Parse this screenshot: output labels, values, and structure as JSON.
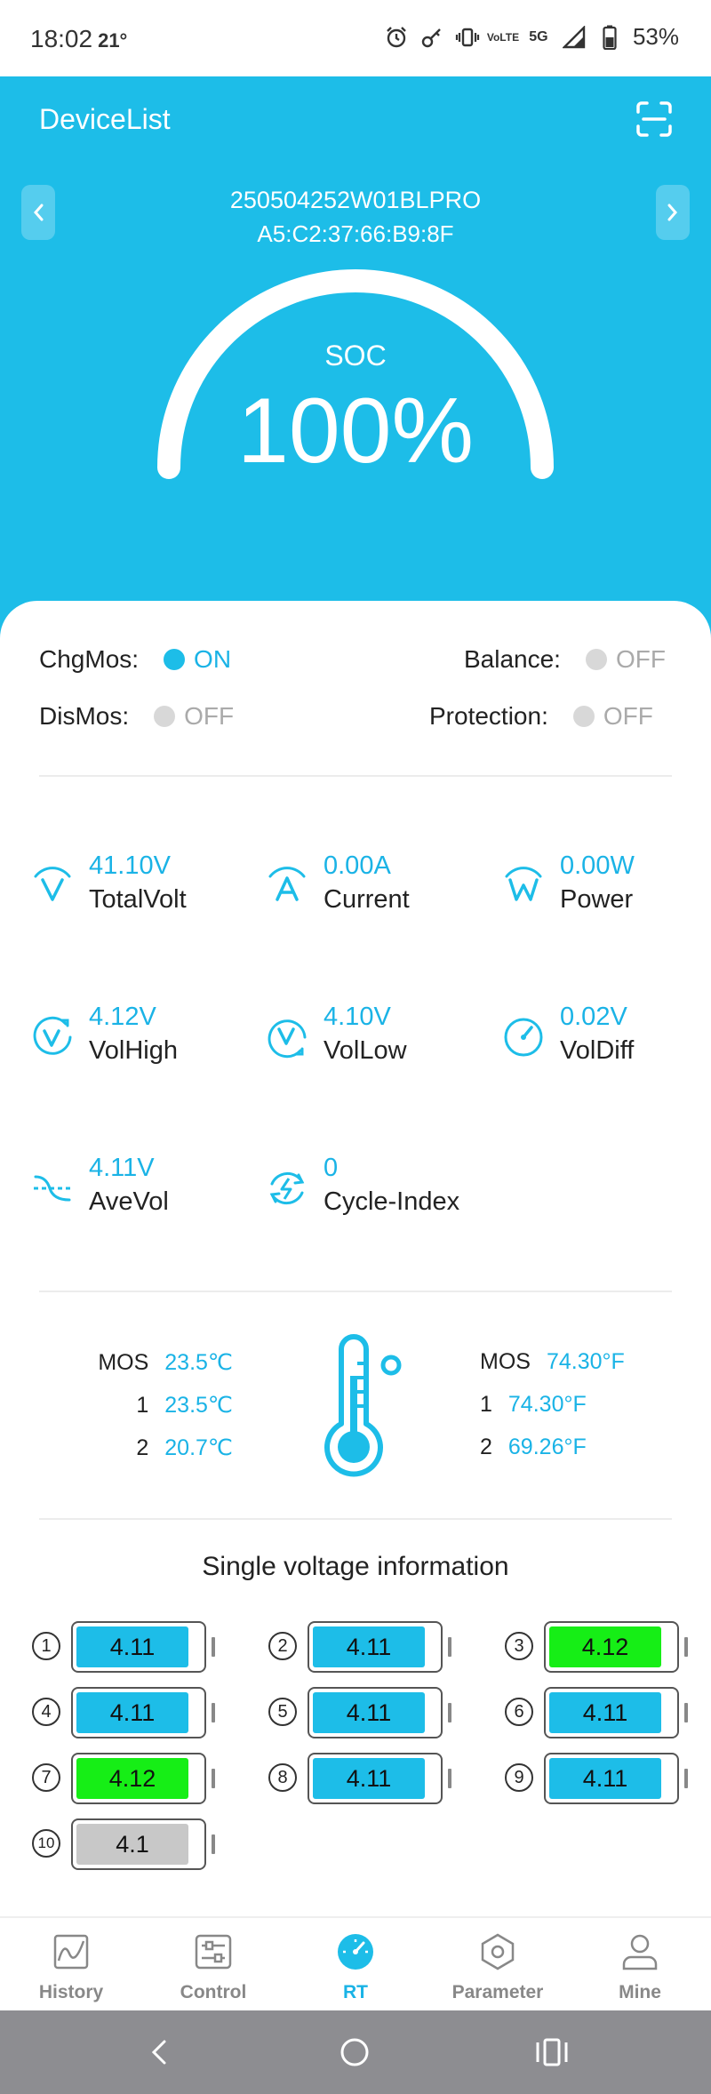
{
  "status_bar": {
    "time": "18:02",
    "temperature": "21°",
    "battery_percent": "53%",
    "net_top": "Vo",
    "net_bottom": "LTE",
    "signal": "5G"
  },
  "header": {
    "title": "DeviceList",
    "device_name": "250504252W01BLPRO",
    "device_mac": "A5:C2:37:66:B9:8F"
  },
  "soc": {
    "label": "SOC",
    "value": "100%",
    "level": 1.0
  },
  "mos": {
    "chg": {
      "label": "ChgMos:",
      "state": "ON",
      "on": true
    },
    "dis": {
      "label": "DisMos:",
      "state": "OFF",
      "on": false
    },
    "balance": {
      "label": "Balance:",
      "state": "OFF",
      "on": false
    },
    "protection": {
      "label": "Protection:",
      "state": "OFF",
      "on": false
    }
  },
  "metrics": {
    "total_volt": {
      "value": "41.10V",
      "label": "TotalVolt"
    },
    "current": {
      "value": "0.00A",
      "label": "Current"
    },
    "power": {
      "value": "0.00W",
      "label": "Power"
    },
    "vol_high": {
      "value": "4.12V",
      "label": "VolHigh"
    },
    "vol_low": {
      "value": "4.10V",
      "label": "VolLow"
    },
    "vol_diff": {
      "value": "0.02V",
      "label": "VolDiff"
    },
    "ave_vol": {
      "value": "4.11V",
      "label": "AveVol"
    },
    "cycle_index": {
      "value": "0",
      "label": "Cycle-Index"
    }
  },
  "temperatures": {
    "celsius": [
      {
        "name": "MOS",
        "value": "23.5℃"
      },
      {
        "name": "1",
        "value": "23.5℃"
      },
      {
        "name": "2",
        "value": "20.7℃"
      }
    ],
    "fahrenheit": [
      {
        "name": "MOS",
        "value": "74.30°F"
      },
      {
        "name": "1",
        "value": "74.30°F"
      },
      {
        "name": "2",
        "value": "69.26°F"
      }
    ]
  },
  "single_voltage": {
    "title": "Single voltage information",
    "cells": [
      {
        "index": "1",
        "value": "4.11",
        "color": "#1dbde8"
      },
      {
        "index": "2",
        "value": "4.11",
        "color": "#1dbde8"
      },
      {
        "index": "3",
        "value": "4.12",
        "color": "#16ee16"
      },
      {
        "index": "4",
        "value": "4.11",
        "color": "#1dbde8"
      },
      {
        "index": "5",
        "value": "4.11",
        "color": "#1dbde8"
      },
      {
        "index": "6",
        "value": "4.11",
        "color": "#1dbde8"
      },
      {
        "index": "7",
        "value": "4.12",
        "color": "#16ee16"
      },
      {
        "index": "8",
        "value": "4.11",
        "color": "#1dbde8"
      },
      {
        "index": "9",
        "value": "4.11",
        "color": "#1dbde8"
      },
      {
        "index": "10",
        "value": "4.1",
        "color": "#c8c8c8"
      }
    ]
  },
  "tabs": {
    "history": {
      "label": "History",
      "icon": "chart-icon"
    },
    "control": {
      "label": "Control",
      "icon": "sliders-icon"
    },
    "rt": {
      "label": "RT",
      "icon": "gauge-icon",
      "active": true
    },
    "parameter": {
      "label": "Parameter",
      "icon": "hexagon-icon"
    },
    "mine": {
      "label": "Mine",
      "icon": "person-icon"
    }
  },
  "colors": {
    "accent": "#1dbde8",
    "cell_high": "#16ee16",
    "cell_low": "#c8c8c8",
    "off_dot": "#d8d8d8"
  }
}
